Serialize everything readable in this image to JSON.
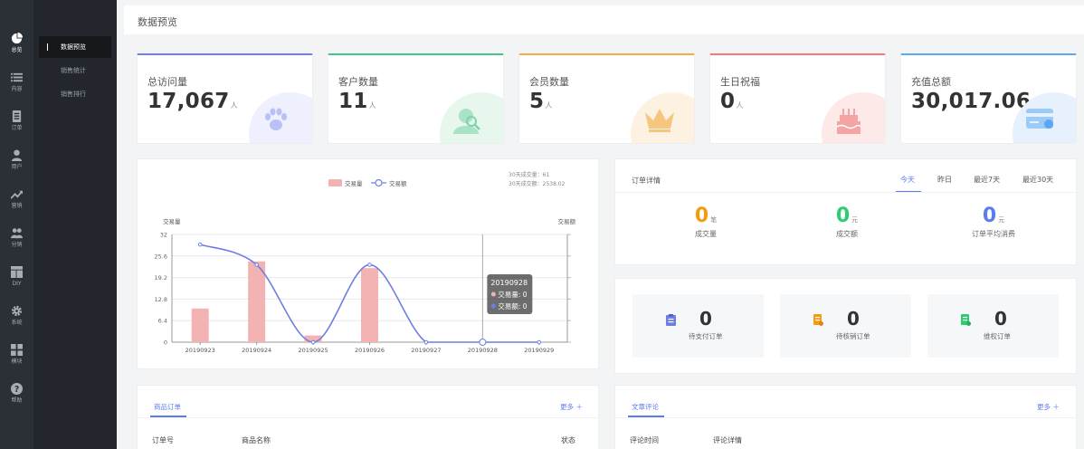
{
  "sidebar": {
    "items": [
      {
        "label": "总览",
        "icon": "pie-chart-icon",
        "active": true
      },
      {
        "label": "内容",
        "icon": "list-icon"
      },
      {
        "label": "订单",
        "icon": "document-icon"
      },
      {
        "label": "用户",
        "icon": "user-icon"
      },
      {
        "label": "营销",
        "icon": "trend-icon"
      },
      {
        "label": "分销",
        "icon": "group-icon"
      },
      {
        "label": "DIY",
        "icon": "layout-icon"
      },
      {
        "label": "系统",
        "icon": "gear-icon"
      },
      {
        "label": "模块",
        "icon": "grid-icon"
      },
      {
        "label": "帮助",
        "icon": "help-icon"
      }
    ]
  },
  "subnav": {
    "items": [
      {
        "label": "数据预览",
        "active": true
      },
      {
        "label": "销售统计"
      },
      {
        "label": "销售排行"
      }
    ]
  },
  "header": {
    "title": "数据预览"
  },
  "stats": [
    {
      "label": "总访问量",
      "value": "17,067",
      "unit": "人",
      "color": "#6f7ff0",
      "icon": "paw-icon"
    },
    {
      "label": "客户数量",
      "value": "11",
      "unit": "人",
      "color": "#44c486",
      "icon": "user-search-icon"
    },
    {
      "label": "会员数量",
      "value": "5",
      "unit": "人",
      "color": "#f2ad4a",
      "icon": "crown-icon"
    },
    {
      "label": "生日祝福",
      "value": "0",
      "unit": "人",
      "color": "#f07a78",
      "icon": "cake-icon"
    },
    {
      "label": "充值总额",
      "value": "30,017.06",
      "unit": "元",
      "color": "#5aa6f2",
      "icon": "card-icon"
    }
  ],
  "chart_data": {
    "type": "bar",
    "categories": [
      "20190923",
      "20190924",
      "20190925",
      "20190926",
      "20190927",
      "20190928",
      "20190929"
    ],
    "series": [
      {
        "name": "交易量",
        "type": "bar",
        "axis": "left",
        "color": "#f4b3b3",
        "values": [
          10,
          24,
          2,
          22,
          0,
          0,
          0
        ]
      },
      {
        "name": "交易额",
        "type": "line",
        "axis": "right",
        "color": "#6f7fe0",
        "values": [
          29,
          23,
          0,
          23,
          0,
          0,
          0
        ]
      }
    ],
    "ylabel": "交易量",
    "y2label": "交易额",
    "yticks": [
      "0",
      "6.4",
      "12.8",
      "19.2",
      "25.6",
      "32"
    ],
    "ylim": [
      0,
      32
    ],
    "y2lim": [
      0,
      32
    ],
    "summary": [
      "30天成交量：61",
      "30天成交额：2538.02"
    ],
    "tooltip": {
      "date": "20190928",
      "lines": [
        "交易量: 0",
        "交易额: 0"
      ],
      "index": 5
    },
    "legend_position": "top-center"
  },
  "order_detail": {
    "title": "订单详情",
    "tabs": [
      {
        "label": "今天",
        "active": true
      },
      {
        "label": "昨日"
      },
      {
        "label": "最近7天"
      },
      {
        "label": "最近30天"
      }
    ],
    "metrics": [
      {
        "value": "0",
        "unit": "笔",
        "caption": "成交量",
        "color": "#f39c12"
      },
      {
        "value": "0",
        "unit": "元",
        "caption": "成交额",
        "color": "#2ecc71"
      },
      {
        "value": "0",
        "unit": "元",
        "caption": "订单平均消费",
        "color": "#5b7cf0"
      }
    ]
  },
  "pending": [
    {
      "value": "0",
      "caption": "待支付订单",
      "color": "#6f7fe0",
      "icon": "clipboard-icon"
    },
    {
      "value": "0",
      "caption": "待核销订单",
      "color": "#f39c12",
      "icon": "voucher-icon"
    },
    {
      "value": "0",
      "caption": "维权订单",
      "color": "#2ecc71",
      "icon": "shield-doc-icon"
    }
  ],
  "goods_orders": {
    "tab": "商品订单",
    "more": "更多 ＋",
    "columns": [
      "订单号",
      "商品名称",
      "状态"
    ]
  },
  "article_comments": {
    "tab": "文章评论",
    "more": "更多 ＋",
    "columns": [
      "评论时间",
      "评论详情"
    ]
  }
}
